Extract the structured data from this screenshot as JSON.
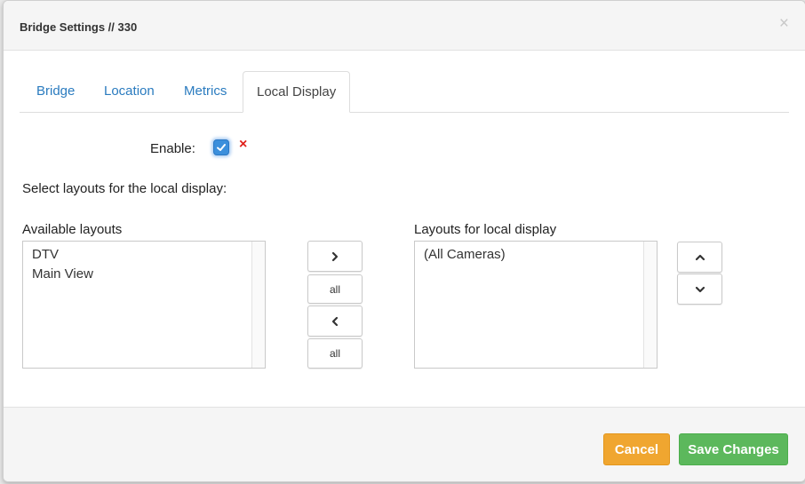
{
  "header": {
    "title": "Bridge Settings // 330",
    "close_label": "×"
  },
  "tabs": [
    {
      "label": "Bridge",
      "active": false
    },
    {
      "label": "Location",
      "active": false
    },
    {
      "label": "Metrics",
      "active": false
    },
    {
      "label": "Local Display",
      "active": true
    }
  ],
  "enable": {
    "label": "Enable:",
    "checked": true,
    "clear_label": "×"
  },
  "instructions": "Select layouts for the local display:",
  "available": {
    "label": "Available layouts",
    "items": [
      "DTV",
      "Main View"
    ]
  },
  "selected": {
    "label": "Layouts for local display",
    "items": [
      "(All Cameras)"
    ]
  },
  "transfer_buttons": {
    "add_icon": "chevron-right-icon",
    "add_all_label": "all",
    "remove_icon": "chevron-left-icon",
    "remove_all_label": "all"
  },
  "order_buttons": {
    "up_icon": "chevron-up-icon",
    "down_icon": "chevron-down-icon"
  },
  "footer": {
    "cancel_label": "Cancel",
    "save_label": "Save Changes"
  },
  "colors": {
    "tab_link": "#2a7bbf",
    "cancel": "#f0a630",
    "save": "#5cb85c",
    "checkbox": "#3b8fdc",
    "clear_x": "#e0201a"
  }
}
